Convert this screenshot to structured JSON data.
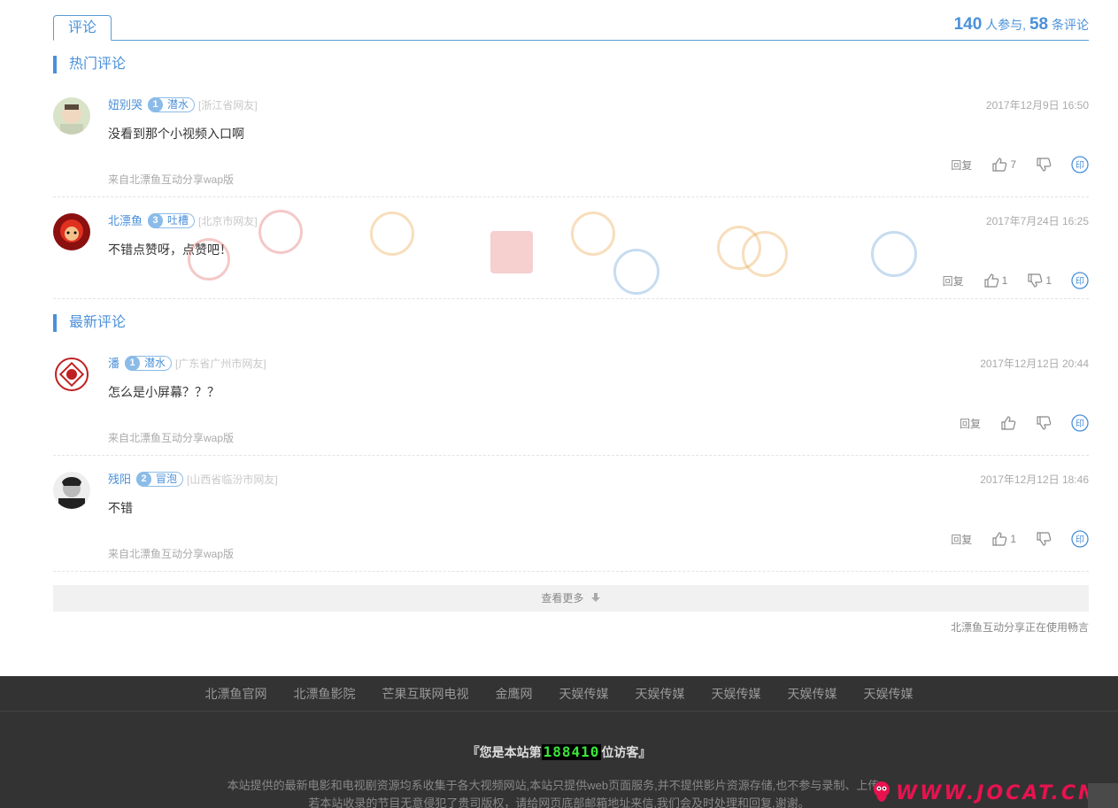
{
  "header": {
    "tab_label": "评论",
    "participants": "140",
    "participants_suffix": "人参与,",
    "comment_count": "58",
    "comment_suffix": "条评论"
  },
  "sections": {
    "hot": "热门评论",
    "latest": "最新评论"
  },
  "comments": [
    {
      "user": "妞别哭",
      "level_num": "1",
      "level_name": "潜水",
      "location": "[浙江省网友]",
      "time": "2017年12月9日 16:50",
      "text": "没看到那个小视频入口啊",
      "reply": "回复",
      "likes": "7",
      "dislikes": "",
      "source": "来自北漂鱼互动分享wap版"
    },
    {
      "user": "北漂鱼",
      "level_num": "3",
      "level_name": "吐槽",
      "location": "[北京市网友]",
      "time": "2017年7月24日 16:25",
      "text": "不错点赞呀，点赞吧！",
      "reply": "回复",
      "likes": "1",
      "dislikes": "1",
      "source": ""
    },
    {
      "user": "潘",
      "level_num": "1",
      "level_name": "潜水",
      "location": "[广东省广州市网友]",
      "time": "2017年12月12日 20:44",
      "text": "怎么是小屏幕？？？",
      "reply": "回复",
      "likes": "",
      "dislikes": "",
      "source": "来自北漂鱼互动分享wap版"
    },
    {
      "user": "残阳",
      "level_num": "2",
      "level_name": "冒泡",
      "location": "[山西省临汾市网友]",
      "time": "2017年12月12日 18:46",
      "text": "不错",
      "reply": "回复",
      "likes": "1",
      "dislikes": "",
      "source": "来自北漂鱼互动分享wap版"
    }
  ],
  "more_label": "查看更多",
  "powered_by": "北漂鱼互动分享正在使用畅言",
  "footer": {
    "links": [
      "北漂鱼官网",
      "北漂鱼影院",
      "芒果互联网电视",
      "金鹰网",
      "天娱传媒",
      "天娱传媒",
      "天娱传媒",
      "天娱传媒",
      "天娱传媒"
    ],
    "visitor_prefix": "『您是本站第",
    "visitor_count": "188410",
    "visitor_suffix": "位访客』",
    "disclaimer_1": "本站提供的最新电影和电视剧资源均系收集于各大视频网站,本站只提供web页面服务,并不提供影片资源存储,也不参与录制、上传。",
    "disclaimer_2": "若本站收录的节目无意侵犯了贵司版权，请给网页底部邮箱地址来信,我们会及时处理和回复,谢谢。"
  },
  "watermark": "WWW.JOCAT.CN",
  "colors": {
    "accent": "#4a90d9",
    "footer_bg": "#333333",
    "watermark": "#e8124f"
  }
}
